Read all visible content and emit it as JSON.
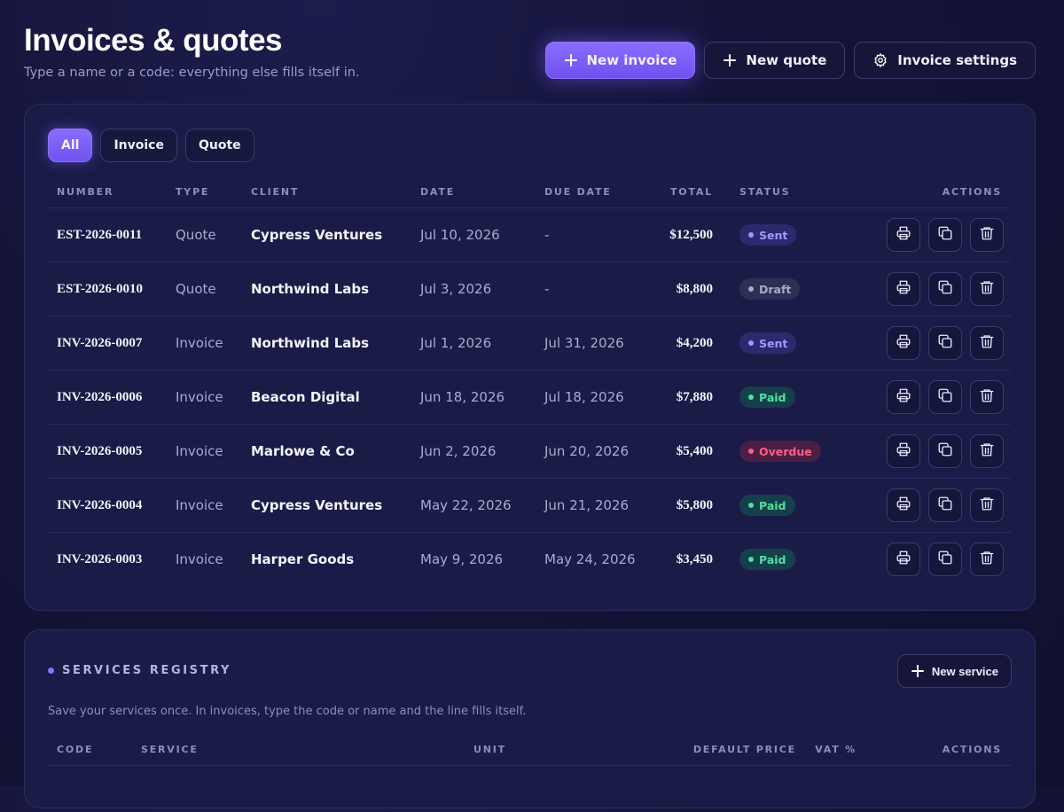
{
  "header": {
    "title": "Invoices & quotes",
    "subtitle": "Type a name or a code: everything else fills itself in."
  },
  "toolbar": {
    "new_invoice": "New invoice",
    "new_quote": "New quote",
    "settings": "Invoice settings"
  },
  "filters": [
    "All",
    "Invoice",
    "Quote"
  ],
  "invoices": {
    "columns": [
      "NUMBER",
      "TYPE",
      "CLIENT",
      "DATE",
      "DUE DATE",
      "TOTAL",
      "STATUS",
      "ACTIONS"
    ],
    "rows": [
      {
        "number": "EST-2026-0011",
        "type": "Quote",
        "client": "Cypress Ventures",
        "date": "Jul 10, 2026",
        "due": "-",
        "total": "$12,500",
        "status": "Sent"
      },
      {
        "number": "EST-2026-0010",
        "type": "Quote",
        "client": "Northwind Labs",
        "date": "Jul 3, 2026",
        "due": "-",
        "total": "$8,800",
        "status": "Draft"
      },
      {
        "number": "INV-2026-0007",
        "type": "Invoice",
        "client": "Northwind Labs",
        "date": "Jul 1, 2026",
        "due": "Jul 31, 2026",
        "total": "$4,200",
        "status": "Sent"
      },
      {
        "number": "INV-2026-0006",
        "type": "Invoice",
        "client": "Beacon Digital",
        "date": "Jun 18, 2026",
        "due": "Jul 18, 2026",
        "total": "$7,880",
        "status": "Paid"
      },
      {
        "number": "INV-2026-0005",
        "type": "Invoice",
        "client": "Marlowe & Co",
        "date": "Jun 2, 2026",
        "due": "Jun 20, 2026",
        "total": "$5,400",
        "status": "Overdue"
      },
      {
        "number": "INV-2026-0004",
        "type": "Invoice",
        "client": "Cypress Ventures",
        "date": "May 22, 2026",
        "due": "Jun 21, 2026",
        "total": "$5,800",
        "status": "Paid"
      },
      {
        "number": "INV-2026-0003",
        "type": "Invoice",
        "client": "Harper Goods",
        "date": "May 9, 2026",
        "due": "May 24, 2026",
        "total": "$3,450",
        "status": "Paid"
      }
    ]
  },
  "services": {
    "title": "SERVICES REGISTRY",
    "new_button": "New service",
    "description": "Save your services once. In invoices, type the code or name and the line fills itself.",
    "columns": [
      "CODE",
      "SERVICE",
      "UNIT",
      "DEFAULT PRICE",
      "VAT %",
      "ACTIONS"
    ]
  },
  "colors": {
    "accent": "#7c5dff",
    "background": "#12123a",
    "panel": "#1a1c47",
    "sent": "#a596ff",
    "paid": "#4ee0a0",
    "overdue": "#ff5d86",
    "draft": "#a9abcc"
  },
  "icons": {
    "new_invoice": "plus-icon",
    "new_quote": "plus-icon",
    "settings": "gear-icon",
    "row_actions": [
      "printer-icon",
      "copy-icon",
      "trash-icon"
    ]
  }
}
